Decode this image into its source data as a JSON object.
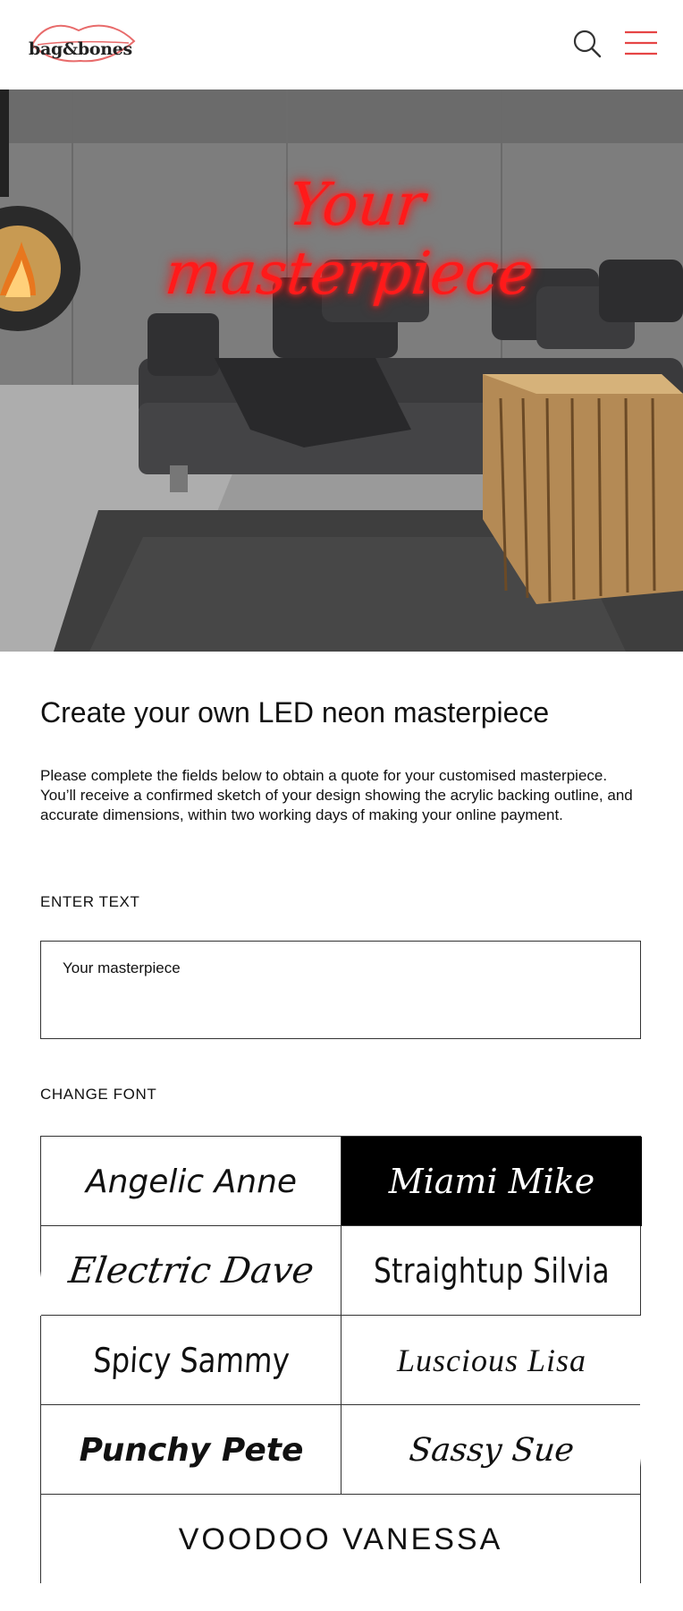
{
  "header": {
    "logo_text": "bag&bones",
    "search_icon": "search-icon",
    "menu_icon": "hamburger-menu-icon",
    "accent_color": "#e64545"
  },
  "hero": {
    "neon_text": "Your masterpiece",
    "neon_color": "#ff1a1a"
  },
  "main": {
    "title": "Create your own LED neon masterpiece",
    "intro": "Please complete the fields below to obtain a quote for your customised masterpiece. You’ll receive a confirmed sketch of your design showing the acrylic backing outline, and accurate dimensions, within two working days of making your online payment.",
    "enter_text_label": "ENTER TEXT",
    "text_value": "Your masterpiece",
    "change_font_label": "CHANGE FONT",
    "fonts": [
      {
        "label": "Angelic Anne",
        "selected": false
      },
      {
        "label": "Miami Mike",
        "selected": true
      },
      {
        "label": "Electric Dave",
        "selected": false
      },
      {
        "label": "Straightup Silvia",
        "selected": false
      },
      {
        "label": "Spicy Sammy",
        "selected": false
      },
      {
        "label": "Luscious Lisa",
        "selected": false
      },
      {
        "label": "Punchy Pete",
        "selected": false
      },
      {
        "label": "Sassy Sue",
        "selected": false
      },
      {
        "label": "VOODOO VANESSA",
        "selected": false
      }
    ]
  }
}
